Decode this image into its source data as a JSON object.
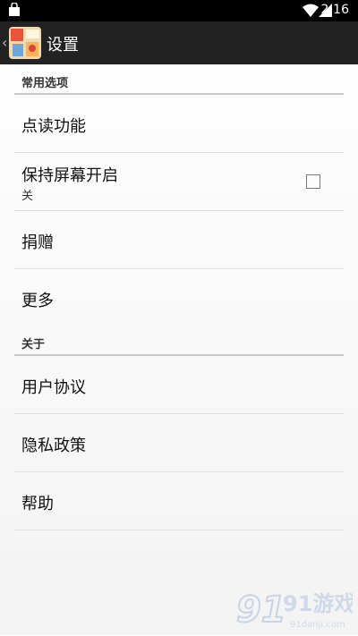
{
  "status_bar": {
    "time": "2:16",
    "icons": [
      "shopping-bag-icon",
      "wifi-icon",
      "signal-icon"
    ]
  },
  "action_bar": {
    "back_icon": "chevron-left-icon",
    "title": "设置"
  },
  "sections": [
    {
      "header": "常用选项",
      "items": [
        {
          "label": "点读功能"
        },
        {
          "label": "保持屏幕开启",
          "summary": "关",
          "checkbox_checked": false
        },
        {
          "label": "捐赠"
        },
        {
          "label": "更多"
        }
      ]
    },
    {
      "header": "关于",
      "items": [
        {
          "label": "用户协议"
        },
        {
          "label": "隐私政策"
        },
        {
          "label": "帮助"
        }
      ]
    }
  ],
  "watermark": {
    "text": "91游戏",
    "subtext": "91danji.com"
  },
  "colors": {
    "status_bar_bg": "#000000",
    "action_bar_bg": "#222222",
    "divider": "#c8c8c8",
    "watermark": "#cfd8e6"
  }
}
